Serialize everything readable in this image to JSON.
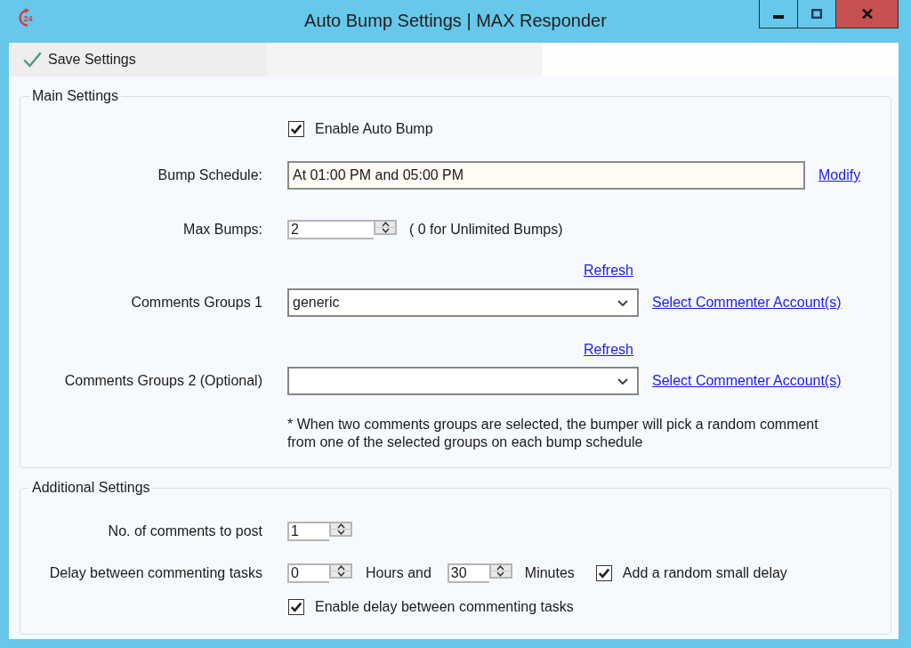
{
  "window": {
    "logo_text": "24",
    "title": "Auto Bump Settings | MAX Responder"
  },
  "toolbar": {
    "save_button": "Save Settings"
  },
  "main_settings": {
    "title": "Main Settings",
    "enable_auto_bump": {
      "label": "Enable Auto Bump",
      "checked": true
    },
    "bump_schedule": {
      "label": "Bump Schedule:",
      "value": "At 01:00 PM and 05:00 PM",
      "link": "Modify"
    },
    "max_bumps": {
      "label": "Max Bumps:",
      "value": "2",
      "hint": "( 0 for Unlimited Bumps)"
    },
    "comments_groups": [
      {
        "refresh": "Refresh",
        "label": "Comments Groups 1",
        "value": "generic",
        "link": "Select Commenter Account(s)"
      },
      {
        "refresh": "Refresh",
        "label": "Comments Groups 2 (Optional)",
        "link": "Select Commenter Account(s)"
      }
    ],
    "note": "* When two comments groups are selected, the bumper will pick a random comment from one of the selected groups on each bump schedule"
  },
  "additional_settings": {
    "title": "Additional Settings",
    "comments_to_post": {
      "label": "No. of comments to post",
      "value": "1"
    },
    "delay": {
      "label": "Delay between commenting tasks",
      "hours": "0",
      "hours_unit": "Hours and",
      "minutes": "30",
      "minutes_unit": "Minutes",
      "random_delay": {
        "label": "Add a random small delay",
        "checked": true
      }
    },
    "enable_delay": {
      "label": "Enable delay between commenting tasks",
      "checked": true
    }
  }
}
